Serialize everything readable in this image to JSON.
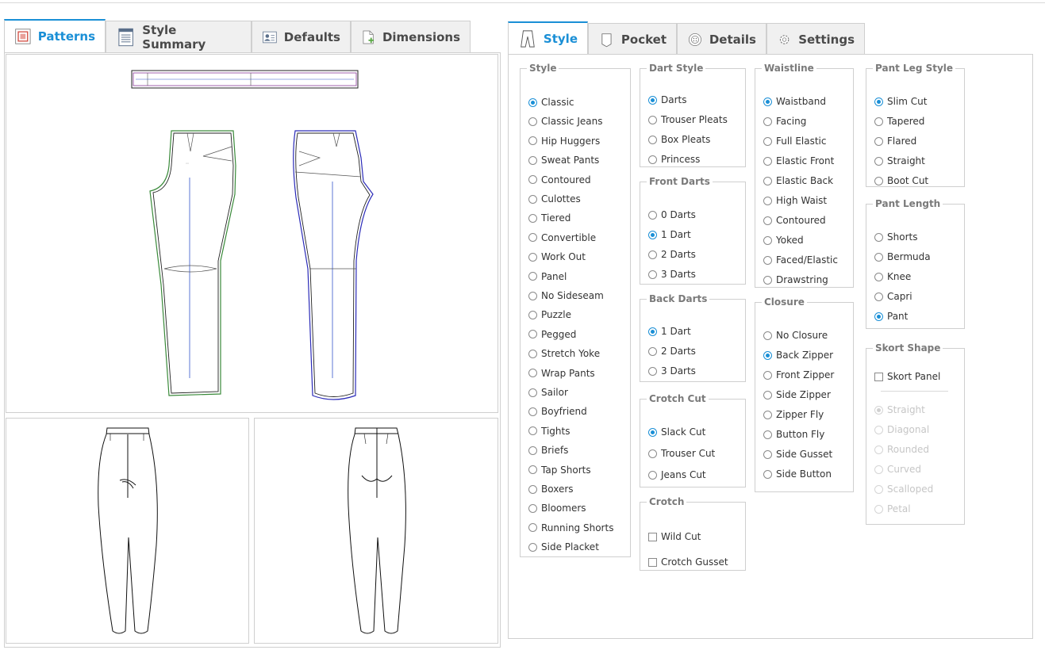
{
  "left_tabs": [
    {
      "label": "Patterns",
      "active": true,
      "icon": "patterns-icon"
    },
    {
      "label": "Style Summary",
      "active": false,
      "icon": "document-icon"
    },
    {
      "label": "Defaults",
      "active": false,
      "icon": "user-card-icon"
    },
    {
      "label": "Dimensions",
      "active": false,
      "icon": "page-add-icon"
    }
  ],
  "right_tabs": [
    {
      "label": "Style",
      "active": true,
      "icon": "pants-icon"
    },
    {
      "label": "Pocket",
      "active": false,
      "icon": "pocket-icon"
    },
    {
      "label": "Details",
      "active": false,
      "icon": "button-icon"
    },
    {
      "label": "Settings",
      "active": false,
      "icon": "gear-icon"
    }
  ],
  "colors": {
    "accent": "#1a8fd6",
    "border": "#cfcfcf",
    "pattern_green": "#3a8a3a",
    "pattern_blue": "#2b2bb8",
    "grainline": "#3355cc",
    "waistband_purple": "#8a3a9a"
  },
  "groups": {
    "style": {
      "legend": "Style",
      "options": [
        "Classic",
        "Classic Jeans",
        "Hip Huggers",
        "Sweat Pants",
        "Contoured",
        "Culottes",
        "Tiered",
        "Convertible",
        "Work Out",
        "Panel",
        "No Sideseam",
        "Puzzle",
        "Pegged",
        "Stretch Yoke",
        "Wrap Pants",
        "Sailor",
        "Boyfriend",
        "Tights",
        "Briefs",
        "Tap Shorts",
        "Boxers",
        "Bloomers",
        "Running Shorts",
        "Side Placket"
      ],
      "selected": "Classic"
    },
    "dart_style": {
      "legend": "Dart Style",
      "options": [
        "Darts",
        "Trouser Pleats",
        "Box Pleats",
        "Princess"
      ],
      "selected": "Darts"
    },
    "front_darts": {
      "legend": "Front Darts",
      "options": [
        "0 Darts",
        "1 Dart",
        "2 Darts",
        "3 Darts"
      ],
      "selected": "1 Dart"
    },
    "back_darts": {
      "legend": "Back Darts",
      "options": [
        "1 Dart",
        "2 Darts",
        "3 Darts"
      ],
      "selected": "1 Dart"
    },
    "crotch_cut": {
      "legend": "Crotch Cut",
      "options": [
        "Slack Cut",
        "Trouser Cut",
        "Jeans Cut"
      ],
      "selected": "Slack Cut"
    },
    "crotch": {
      "legend": "Crotch",
      "checks": [
        {
          "label": "Wild Cut",
          "checked": false
        },
        {
          "label": "Crotch Gusset",
          "checked": false
        }
      ]
    },
    "waistline": {
      "legend": "Waistline",
      "options": [
        "Waistband",
        "Facing",
        "Full Elastic",
        "Elastic Front",
        "Elastic Back",
        "High Waist",
        "Contoured",
        "Yoked",
        "Faced/Elastic",
        "Drawstring"
      ],
      "selected": "Waistband"
    },
    "closure": {
      "legend": "Closure",
      "options": [
        "No Closure",
        "Back Zipper",
        "Front Zipper",
        "Side Zipper",
        "Zipper Fly",
        "Button Fly",
        "Side Gusset",
        "Side Button"
      ],
      "selected": "Back Zipper"
    },
    "pant_leg_style": {
      "legend": "Pant Leg Style",
      "options": [
        "Slim Cut",
        "Tapered",
        "Flared",
        "Straight",
        "Boot Cut"
      ],
      "selected": "Slim Cut"
    },
    "pant_length": {
      "legend": "Pant Length",
      "options": [
        "Shorts",
        "Bermuda",
        "Knee",
        "Capri",
        "Pant"
      ],
      "selected": "Pant"
    },
    "skort_shape": {
      "legend": "Skort Shape",
      "check": {
        "label": "Skort Panel",
        "checked": false
      },
      "options": [
        "Straight",
        "Diagonal",
        "Rounded",
        "Curved",
        "Scalloped",
        "Petal"
      ],
      "selected": "Straight",
      "disabled": true
    }
  }
}
